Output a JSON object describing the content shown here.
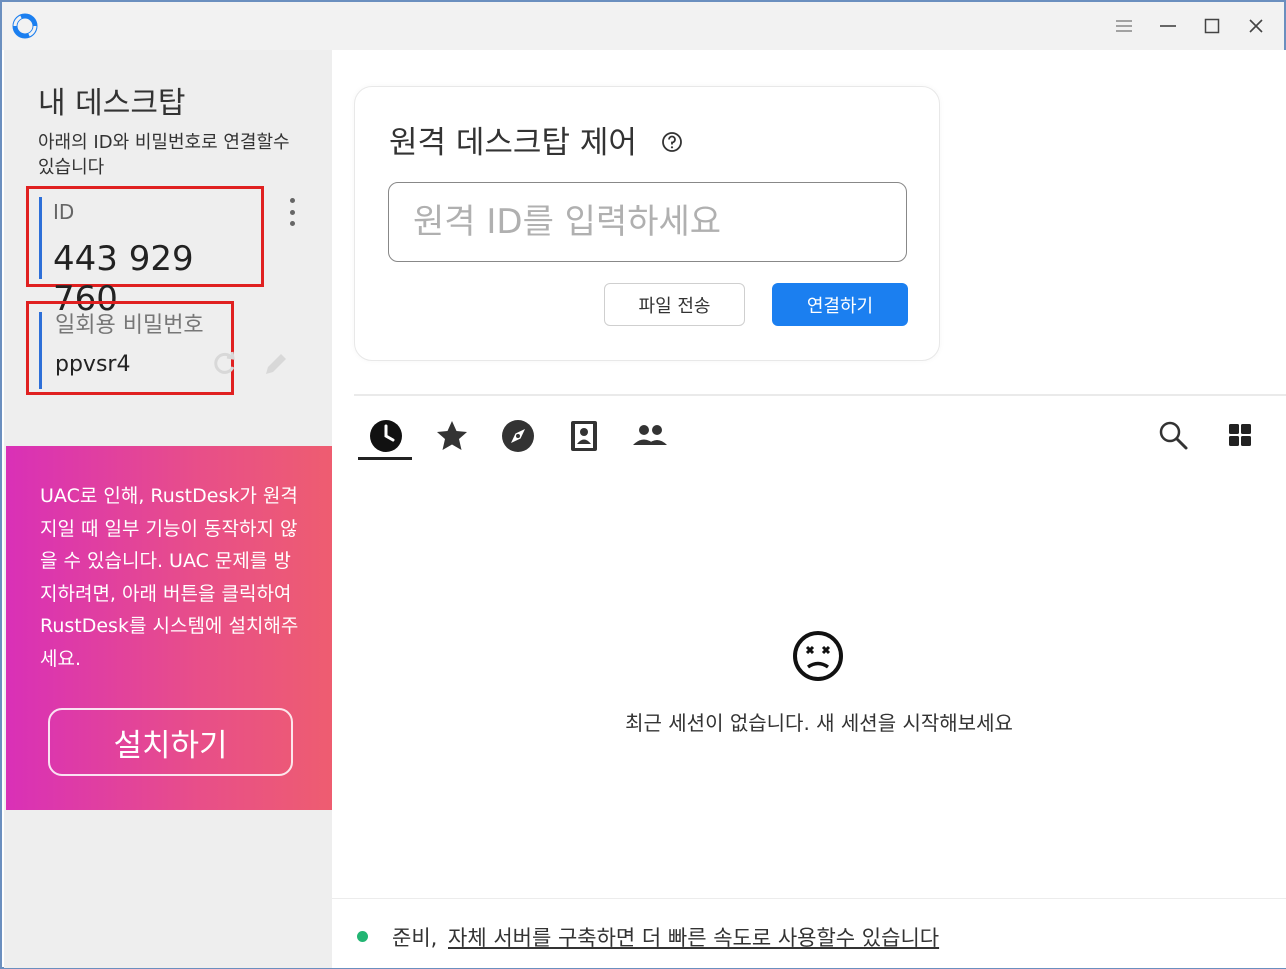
{
  "left": {
    "title": "내 데스크탑",
    "subtitle": "아래의 ID와 비밀번호로 연결할수 있습니다",
    "id_label": "ID",
    "id_value": "443 929 760",
    "pw_label": "일회용 비밀번호",
    "pw_value": "ppvsr4",
    "uac_message": "UAC로 인해, RustDesk가 원격지일 때 일부 기능이 동작하지 않을 수 있습니다. UAC 문제를 방지하려면, 아래 버튼을 클릭하여 RustDesk를 시스템에 설치해주세요.",
    "install_label": "설치하기"
  },
  "remote": {
    "title": "원격 데스크탑 제어",
    "input_placeholder": "원격 ID를 입력하세요",
    "file_transfer_label": "파일 전송",
    "connect_label": "연결하기"
  },
  "tabs": [
    "recent-sessions",
    "favorites",
    "discovered",
    "address-book",
    "group"
  ],
  "sessions": {
    "empty_message": "최근 세션이 없습니다. 새 세션을 시작해보세요"
  },
  "status": {
    "ready_text": "준비,",
    "link_text": "자체 서버를 구축하면 더 빠른 속도로 사용할수 있습니다"
  },
  "colors": {
    "accent": "#1b7ff0",
    "status_ready": "#22b573",
    "uac_gradient_start": "#d930b7",
    "uac_gradient_end": "#ee5d70",
    "highlight_box": "#e02020"
  }
}
